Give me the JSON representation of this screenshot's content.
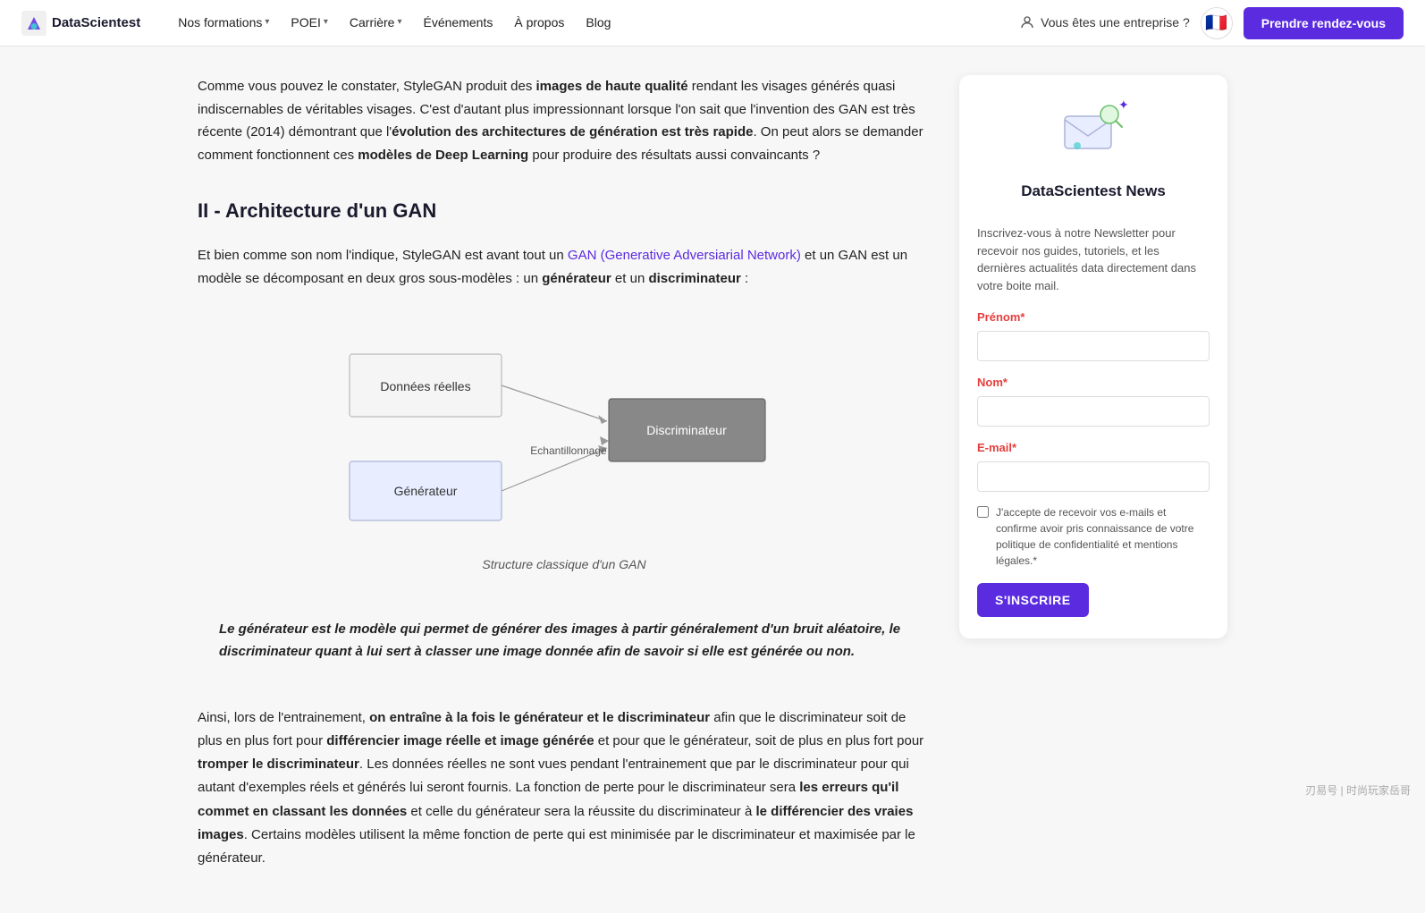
{
  "nav": {
    "logo_text": "DataScientest",
    "items": [
      {
        "label": "Nos formations",
        "has_chevron": true
      },
      {
        "label": "POEI",
        "has_chevron": true
      },
      {
        "label": "Carrière",
        "has_chevron": true
      },
      {
        "label": "Événements",
        "has_chevron": false
      },
      {
        "label": "À propos",
        "has_chevron": false
      },
      {
        "label": "Blog",
        "has_chevron": false
      }
    ],
    "enterprise_label": "Vous êtes une entreprise ?",
    "flag_emoji": "🇫🇷",
    "rdv_label": "Prendre rendez-vous"
  },
  "article": {
    "intro_para": "Comme vous pouvez le constater, StyleGAN produit des ",
    "intro_bold1": "images de haute qualité",
    "intro_mid1": " rendant les visages générés quasi indiscernables de véritables visages. C'est d'autant plus impressionnant lorsque l'on sait que l'invention des GAN est très récente (2014) démontrant que l'",
    "intro_bold2": "évolution des architectures de génération est très rapide",
    "intro_end": ". On peut alors se demander comment fonctionnent ces ",
    "intro_bold3": "modèles de Deep Learning",
    "intro_end2": " pour produire des résultats aussi convaincants ?",
    "section_heading": "II - Architecture d'un GAN",
    "section_para1_start": "Et bien comme son nom l'indique, StyleGAN est avant tout un ",
    "section_link_text": "GAN (Generative Adversiarial Network)",
    "section_para1_end": " et un GAN est un modèle se décomposant en deux gros sous-modèles : un ",
    "section_bold1": "générateur",
    "section_para1_mid": " et un ",
    "section_bold2": "discriminateur",
    "section_para1_tail": " :",
    "diagram_caption": "Structure classique d'un GAN",
    "diagram": {
      "box_donnees": "Données réelles",
      "box_generateur": "Générateur",
      "box_discriminateur": "Discriminateur",
      "arrow_label": "Echantillonnage"
    },
    "blockquote": "Le générateur est le modèle qui permet de générer des images à partir généralement d'un bruit aléatoire, le discriminateur quant à lui sert à classer une image donnée afin de savoir si elle est générée ou non.",
    "body_para1_start": "Ainsi, lors de l'entrainement, ",
    "body_para1_bold1": "on entraîne à la fois le générateur et le discriminateur",
    "body_para1_mid1": " afin que le discriminateur soit de plus en plus fort pour ",
    "body_para1_bold2": "différencier image réelle et image générée",
    "body_para1_mid2": " et pour que le générateur, soit de plus en plus fort pour ",
    "body_para1_bold3": "tromper le discriminateur",
    "body_para1_mid3": ". Les données réelles ne sont vues pendant l'entrainement que par le discriminateur pour qui autant d'exemples réels et générés lui seront fournis. La fonction de perte pour le discriminateur sera ",
    "body_para1_bold4": "les erreurs qu'il commet en classant les données",
    "body_para1_mid4": " et celle du générateur sera la réussite du discriminateur à ",
    "body_para1_bold5": "le différencier des vraies images",
    "body_para1_end": ". Certains modèles utilisent la même fonction de perte qui est minimisée par le discriminateur et maximisée par le générateur."
  },
  "sidebar": {
    "title": "DataScientest News",
    "description": "Inscrivez-vous à notre Newsletter pour recevoir nos guides, tutoriels, et les dernières actualités data directement dans votre boite mail.",
    "field_prenom_label": "Prénom",
    "field_prenom_required": "*",
    "field_nom_label": "Nom",
    "field_nom_required": "*",
    "field_email_label": "E-mail",
    "field_email_required": "*",
    "checkbox_text": "J'accepte de recevoir vos e-mails et confirme avoir pris connaissance de votre politique de confidentialité et mentions légales.",
    "checkbox_required": "*",
    "subscribe_label": "S'INSCRIRE"
  },
  "watermark": "刃易号 | 时尚玩家岳哥"
}
